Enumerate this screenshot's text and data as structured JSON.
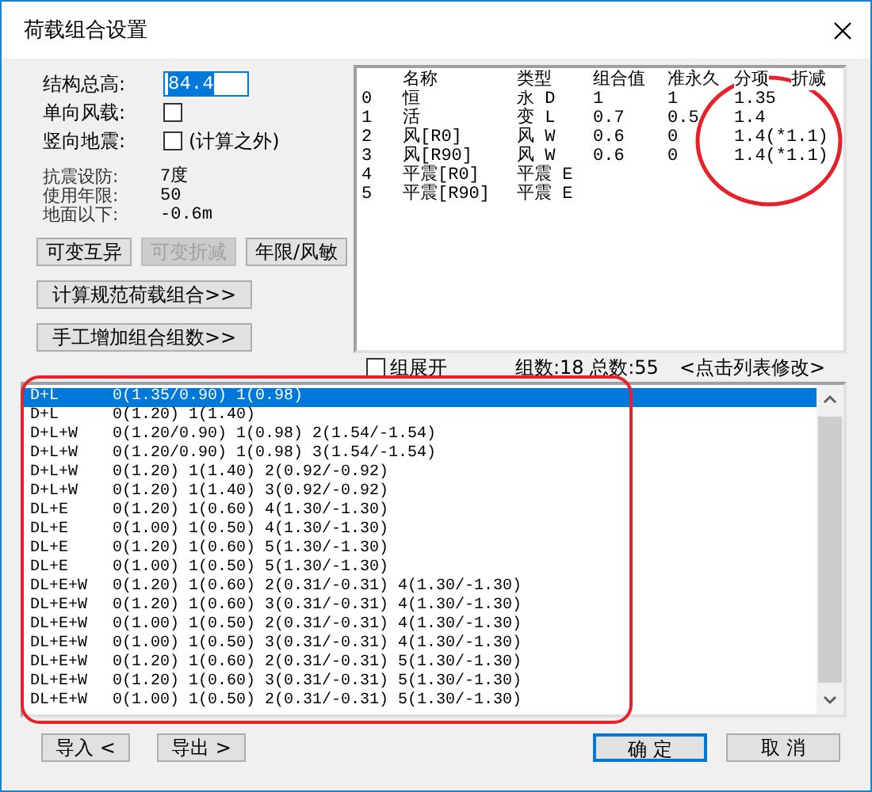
{
  "window": {
    "title": "荷载组合设置"
  },
  "settings": {
    "height_label": "结构总高:",
    "height_value": "84.4",
    "wind_label": "单向风载:",
    "wind_checked": false,
    "vertical_label": "竖向地震:",
    "vertical_checked": false,
    "vertical_note": "(计算之外)"
  },
  "info": [
    {
      "label": "抗震设防:",
      "value": "7度"
    },
    {
      "label": "使用年限:",
      "value": "50"
    },
    {
      "label": "地面以下:",
      "value": "-0.6m"
    }
  ],
  "option_buttons": [
    {
      "label": "可变互异",
      "disabled": false
    },
    {
      "label": "可变折减",
      "disabled": true
    },
    {
      "label": "年限/风敏",
      "disabled": false
    }
  ],
  "wide_buttons": [
    "计算规范荷载组合>>",
    "手工增加组合组数>>"
  ],
  "load_table": {
    "columns": [
      "名称",
      "类型",
      "组合值",
      "准永久",
      "分项",
      "折减"
    ],
    "rows": [
      {
        "index": "0",
        "name": "恒",
        "type": "永 D",
        "combination": "1",
        "quasi": "1",
        "factor": "1.35"
      },
      {
        "index": "1",
        "name": "活",
        "type": "变 L",
        "combination": "0.7",
        "quasi": "0.5",
        "factor": "1.4"
      },
      {
        "index": "2",
        "name": "风[R0]",
        "type": "风 W",
        "combination": "0.6",
        "quasi": "0",
        "factor": "1.4(*1.1)"
      },
      {
        "index": "3",
        "name": "风[R90]",
        "type": "风 W",
        "combination": "0.6",
        "quasi": "0",
        "factor": "1.4(*1.1)"
      },
      {
        "index": "4",
        "name": "平震[R0]",
        "type": "平震 E"
      },
      {
        "index": "5",
        "name": "平震[R90]",
        "type": "平震 E"
      }
    ]
  },
  "expand": {
    "label": "组展开",
    "checked": false
  },
  "counts": "组数:18 总数:55",
  "hint": "<点击列表修改>",
  "combinations": [
    {
      "name": "D+L",
      "terms": "0(1.35/0.90) 1(0.98)",
      "selected": true
    },
    {
      "name": "D+L",
      "terms": "0(1.20) 1(1.40)",
      "selected": false
    },
    {
      "name": "D+L+W",
      "terms": "0(1.20/0.90) 1(0.98) 2(1.54/-1.54)",
      "selected": false
    },
    {
      "name": "D+L+W",
      "terms": "0(1.20/0.90) 1(0.98) 3(1.54/-1.54)",
      "selected": false
    },
    {
      "name": "D+L+W",
      "terms": "0(1.20) 1(1.40) 2(0.92/-0.92)",
      "selected": false
    },
    {
      "name": "D+L+W",
      "terms": "0(1.20) 1(1.40) 3(0.92/-0.92)",
      "selected": false
    },
    {
      "name": "DL+E",
      "terms": "0(1.20) 1(0.60) 4(1.30/-1.30)",
      "selected": false
    },
    {
      "name": "DL+E",
      "terms": "0(1.00) 1(0.50) 4(1.30/-1.30)",
      "selected": false
    },
    {
      "name": "DL+E",
      "terms": "0(1.20) 1(0.60) 5(1.30/-1.30)",
      "selected": false
    },
    {
      "name": "DL+E",
      "terms": "0(1.00) 1(0.50) 5(1.30/-1.30)",
      "selected": false
    },
    {
      "name": "DL+E+W",
      "terms": "0(1.20) 1(0.60) 2(0.31/-0.31) 4(1.30/-1.30)",
      "selected": false
    },
    {
      "name": "DL+E+W",
      "terms": "0(1.20) 1(0.60) 3(0.31/-0.31) 4(1.30/-1.30)",
      "selected": false
    },
    {
      "name": "DL+E+W",
      "terms": "0(1.00) 1(0.50) 2(0.31/-0.31) 4(1.30/-1.30)",
      "selected": false
    },
    {
      "name": "DL+E+W",
      "terms": "0(1.00) 1(0.50) 3(0.31/-0.31) 4(1.30/-1.30)",
      "selected": false
    },
    {
      "name": "DL+E+W",
      "terms": "0(1.20) 1(0.60) 2(0.31/-0.31) 5(1.30/-1.30)",
      "selected": false
    },
    {
      "name": "DL+E+W",
      "terms": "0(1.20) 1(0.60) 3(0.31/-0.31) 5(1.30/-1.30)",
      "selected": false
    },
    {
      "name": "DL+E+W",
      "terms": "0(1.00) 1(0.50) 2(0.31/-0.31) 5(1.30/-1.30)",
      "selected": false
    }
  ],
  "footer": {
    "import": "导入 <",
    "export": "导出 >",
    "ok": "确 定",
    "cancel": "取 消"
  },
  "annotations": [
    {
      "kind": "ellipse"
    },
    {
      "kind": "rounded-rect"
    }
  ]
}
